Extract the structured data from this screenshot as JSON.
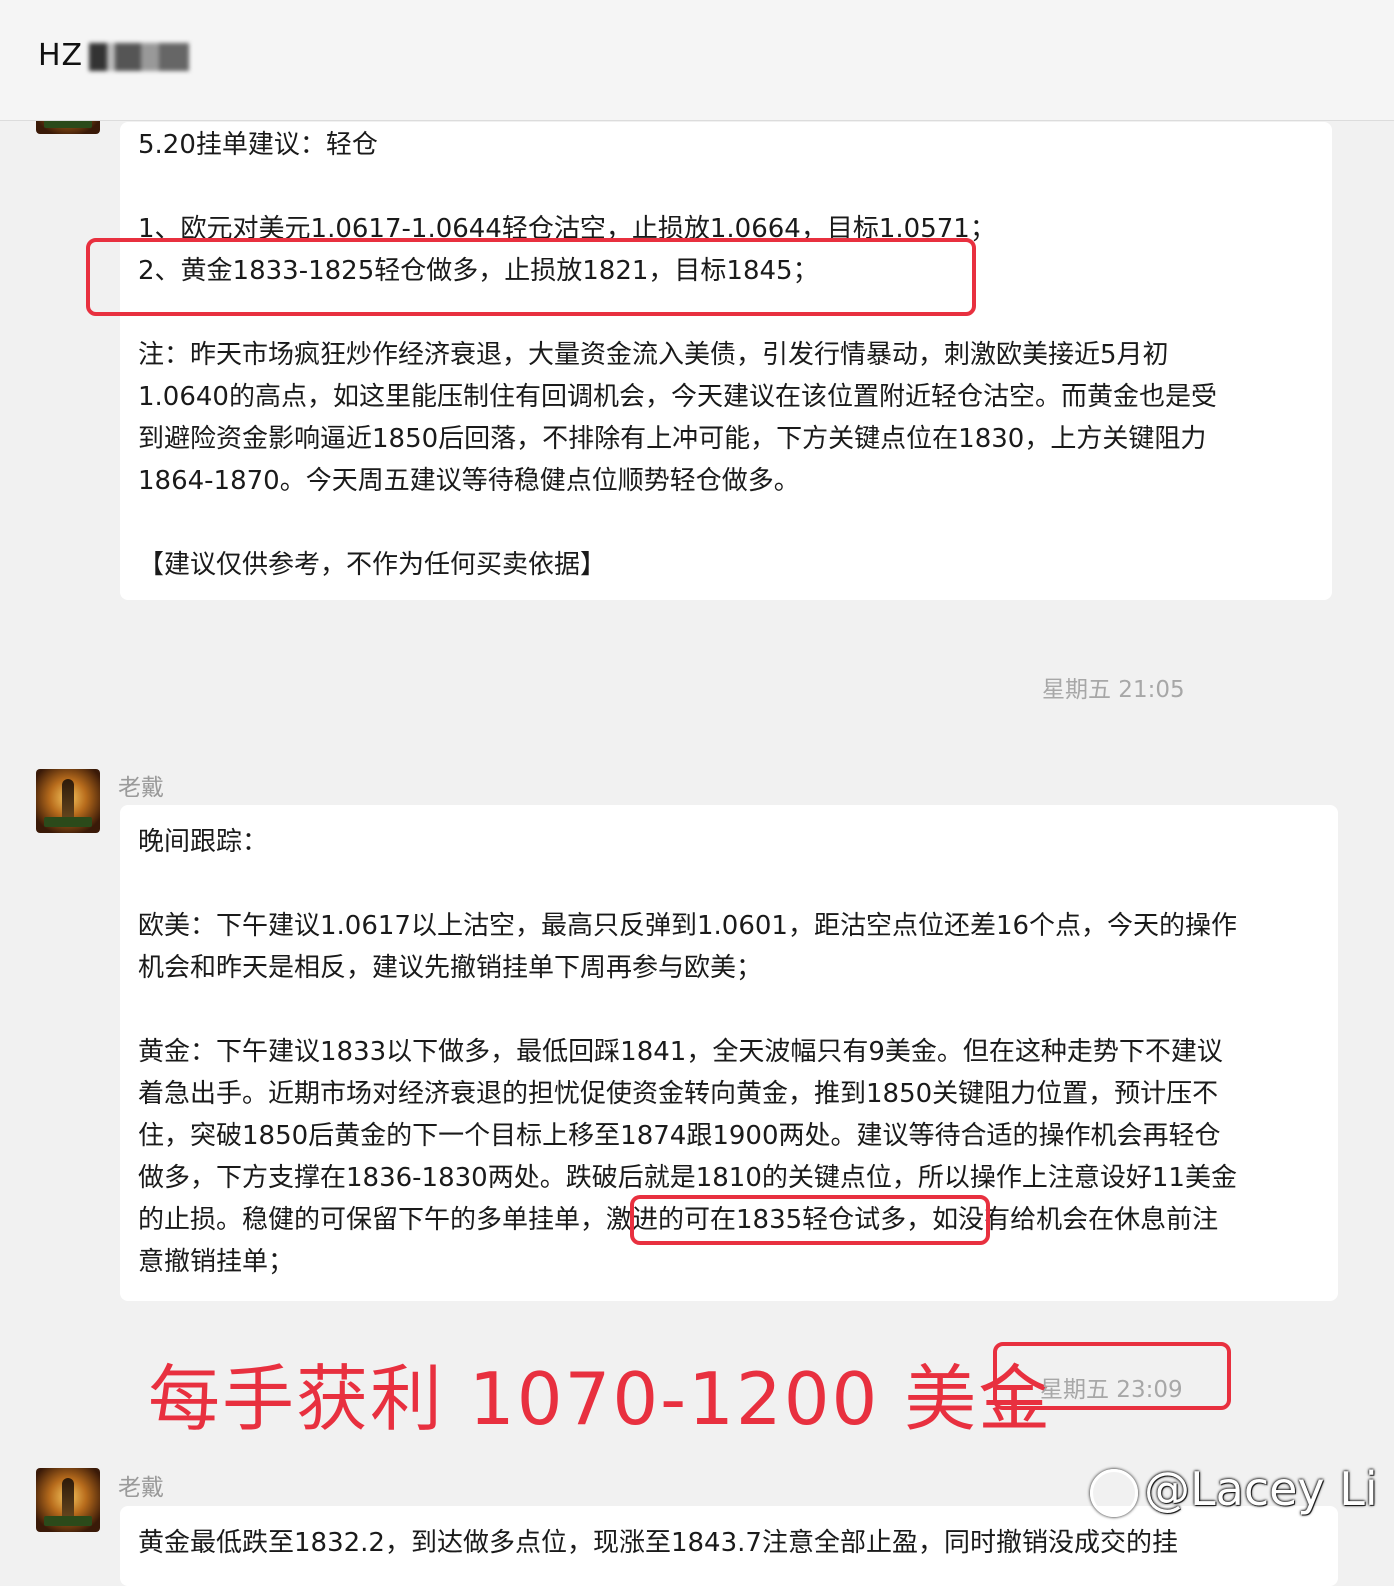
{
  "header": {
    "title": "HZ"
  },
  "messages": [
    {
      "lines": [
        "5.20挂单建议：轻仓",
        "",
        "1、欧元对美元1.0617-1.0644轻仓沽空，止损放1.0664，目标1.0571；",
        "2、黄金1833-1825轻仓做多，止损放1821，目标1845；",
        "",
        "注：昨天市场疯狂炒作经济衰退，大量资金流入美债，引发行情暴动，刺激欧美接近5月初",
        "1.0640的高点，如这里能压制住有回调机会，今天建议在该位置附近轻仓沽空。而黄金也是受",
        "到避险资金影响逼近1850后回落，不排除有上冲可能，下方关键点位在1830，上方关键阻力",
        "1864-1870。今天周五建议等待稳健点位顺势轻仓做多。",
        "",
        "【建议仅供参考，不作为任何买卖依据】"
      ],
      "time": "星期五 21:05"
    },
    {
      "sender": "老戴",
      "lines": [
        "晚间跟踪：",
        "",
        "欧美：下午建议1.0617以上沽空，最高只反弹到1.0601，距沽空点位还差16个点，今天的操作",
        "机会和昨天是相反，建议先撤销挂单下周再参与欧美；",
        "",
        "黄金：下午建议1833以下做多，最低回踩1841，全天波幅只有9美金。但在这种走势下不建议",
        "着急出手。近期市场对经济衰退的担忧促使资金转向黄金，推到1850关键阻力位置，预计压不",
        "住，突破1850后黄金的下一个目标上移至1874跟1900两处。建议等待合适的操作机会再轻仓",
        "做多，下方支撑在1836-1830两处。跌破后就是1810的关键点位，所以操作上注意设好11美金",
        "的止损。稳健的可保留下午的多单挂单，激进的可在1835轻仓试多，如没有给机会在休息前注",
        "意撤销挂单；"
      ],
      "time": "星期五 23:09"
    },
    {
      "sender": "老戴",
      "lines": [
        "黄金最低跌至1832.2，到达做多点位，现涨至1843.7注意全部止盈，同时撤销没成交的挂"
      ]
    }
  ],
  "annotation": {
    "profit_text": "每手获利 1070-1200 美金"
  },
  "watermark": {
    "text": "@Lacey Li"
  },
  "colors": {
    "highlight": "#e8303f",
    "background": "#f1f1f1",
    "bubble": "#ffffff"
  }
}
